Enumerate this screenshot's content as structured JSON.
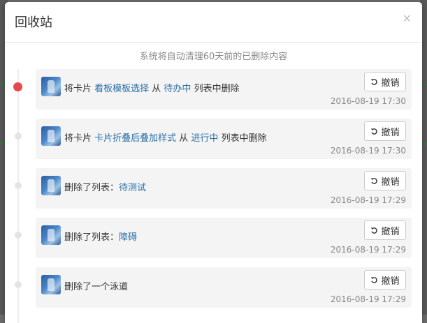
{
  "modal": {
    "title": "回收站",
    "close": "×",
    "notice": "系统将自动清理60天前的已删除内容"
  },
  "undo_label": "撤销",
  "entries": [
    {
      "prefix": "将卡片 ",
      "link1": "看板模板选择",
      "mid": " 从 ",
      "link2": "待办中",
      "suffix": " 列表中删除",
      "time": "2016-08-19 17:30"
    },
    {
      "prefix": "将卡片 ",
      "link1": "卡片折叠后叠加样式",
      "mid": " 从 ",
      "link2": "进行中",
      "suffix": " 列表中删除",
      "time": "2016-08-19 17:30"
    },
    {
      "prefix": "删除了列表：",
      "link1": "待测试",
      "time": "2016-08-19 17:29"
    },
    {
      "prefix": "删除了列表：",
      "link1": "障碍",
      "time": "2016-08-19 17:29"
    },
    {
      "prefix": "删除了一个泳道",
      "time": "2016-08-19 17:29"
    }
  ]
}
